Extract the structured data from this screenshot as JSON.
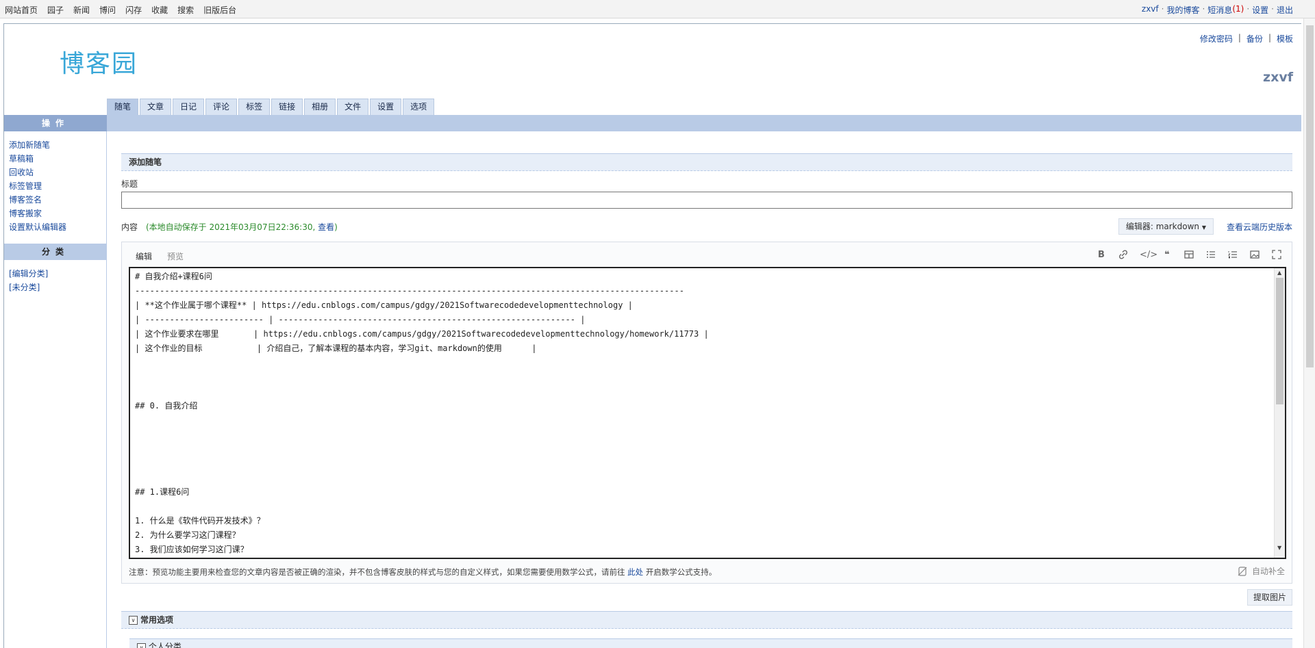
{
  "topbar": {
    "left": [
      "网站首页",
      "园子",
      "新闻",
      "博问",
      "闪存",
      "收藏",
      "搜索",
      "旧版后台"
    ],
    "user": "zxvf",
    "my_blog": "我的博客",
    "messages": "短消息",
    "unread": "(1)",
    "settings": "设置",
    "logout": "退出"
  },
  "header": {
    "logo": "博客园",
    "change_password": "修改密码",
    "backup": "备份",
    "template": "模板",
    "username": "zxvf"
  },
  "tabs": [
    "随笔",
    "文章",
    "日记",
    "评论",
    "标签",
    "链接",
    "相册",
    "文件",
    "设置",
    "选项"
  ],
  "sidebar": {
    "ops_title": "操作",
    "ops": [
      "添加新随笔",
      "草稿箱",
      "回收站",
      "标签管理",
      "博客签名",
      "博客搬家",
      "设置默认编辑器"
    ],
    "cat_title": "分类",
    "cats": [
      "[编辑分类]",
      "[未分类]"
    ]
  },
  "main": {
    "section_title": "添加随笔",
    "title_label": "标题",
    "content_label": "内容",
    "autosave_text": "(本地自动保存于 2021年03月07日22:36:30,",
    "autosave_view": "查看",
    "autosave_end": ")",
    "editor_select": "编辑器: markdown",
    "history_link": "查看云端历史版本",
    "edit_tab": "编辑",
    "preview_tab": "预览",
    "code": "# 自我介绍+课程6问\n---------------------------------------------------------------------------------------------------------------\n| **这个作业属于哪个课程** | https://edu.cnblogs.com/campus/gdgy/2021Softwarecodedevelopmenttechnology |\n| ------------------------ | ------------------------------------------------------------ |\n| 这个作业要求在哪里       | https://edu.cnblogs.com/campus/gdgy/2021Softwarecodedevelopmenttechnology/homework/11773 |\n| 这个作业的目标           | 介绍自己，了解本课程的基本内容，学习git、markdown的使用      |\n\n\n\n## 0. 自我介绍\n\n\n\n\n\n## 1.课程6问\n\n1. 什么是《软件代码开发技术》？\n2. 为什么要学习这门课程？\n3. 我们应该如何学习这门课？",
    "note_text": "注意：预览功能主要用来检查您的文章内容是否被正确的渲染，并不包含博客皮肤的样式与您的自定义样式，如果您需要使用数学公式，请前往",
    "note_link": "此处",
    "note_end": "开启数学公式支持。",
    "autocomplete": "自动补全",
    "fetch_images": "提取图片",
    "options_title": "常用选项",
    "sub_option": "个人分类"
  }
}
